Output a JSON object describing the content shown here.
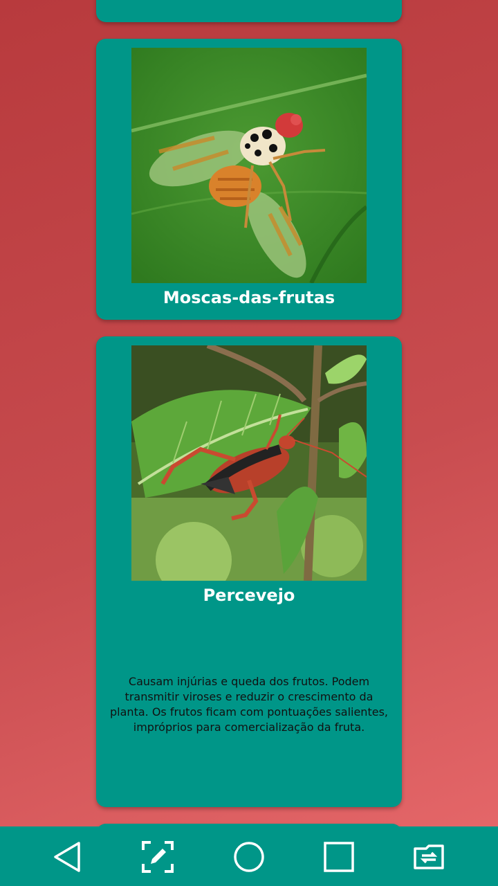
{
  "cards": [
    {
      "title": "Moscas-das-frutas",
      "image": "fruit-fly-photo"
    },
    {
      "title": "Percevejo",
      "image": "stink-bug-photo",
      "description": "Causam injúrias e queda dos frutos. Podem transmitir viroses e reduzir o crescimento da planta. Os frutos ficam com pontuações salientes, impróprios para comercialização da fruta."
    }
  ],
  "colors": {
    "card": "#009688",
    "background": "#c84c4f",
    "navbar": "#009688"
  },
  "navbar": {
    "buttons": [
      "back-icon",
      "screenshot-edit-icon",
      "home-icon",
      "recents-icon",
      "rotate-screen-icon"
    ]
  }
}
